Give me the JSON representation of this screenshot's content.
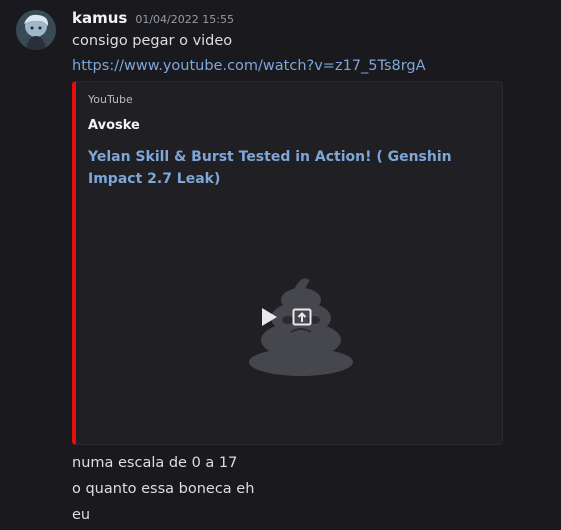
{
  "message": {
    "username": "kamus",
    "timestamp": "01/04/2022 15:55",
    "lines_before": [
      "consigo pegar o video"
    ],
    "link": "https://www.youtube.com/watch?v=z17_5Ts8rgA",
    "lines_after": [
      "numa escala de 0 a 17",
      "o quanto essa boneca eh",
      "eu"
    ]
  },
  "embed": {
    "provider": "YouTube",
    "author": "Avoske",
    "title": "Yelan Skill & Burst Tested in Action! ( Genshin Impact 2.7 Leak)",
    "accent_color": "#e60d0d",
    "media_icons": [
      "play-icon",
      "open-external-icon"
    ]
  },
  "colors": {
    "background": "#1a1a1e",
    "link": "#7ea6d8",
    "text": "#dbdee1"
  }
}
